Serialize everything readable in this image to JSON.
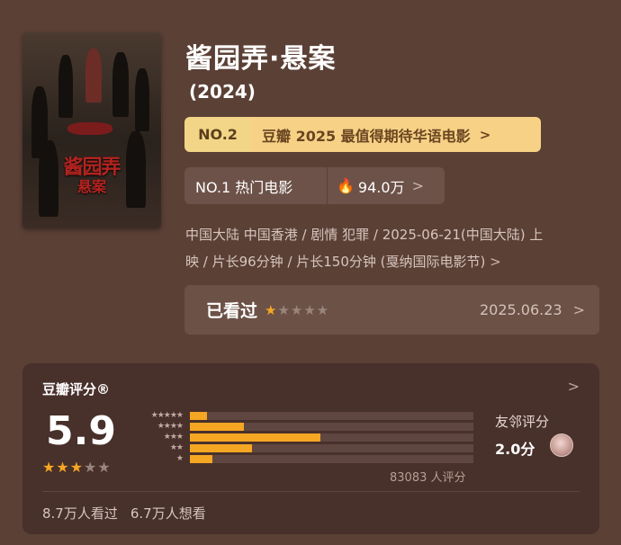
{
  "title": "酱园弄·悬案",
  "year": "(2024)",
  "poster": {
    "title_line1": "酱园弄",
    "title_line2": "悬案"
  },
  "rank1": {
    "no": "NO.2",
    "label": "豆瓣 2025 最值得期待华语电影"
  },
  "rank2": {
    "no_label": "NO.1 热门电影",
    "heat": "94.0万"
  },
  "meta": {
    "line1": "中国大陆 中国香港 / 剧情 犯罪 / 2025-06-21(中国大陆) 上",
    "line2": "映 / 片长96分钟 / 片长150分钟 (戛纳国际电影节)"
  },
  "watched": {
    "label": "已看过",
    "user_stars": 1,
    "date": "2025.06.23"
  },
  "rating": {
    "header": "豆瓣评分®",
    "score": "5.9",
    "stars": 3,
    "distribution": [
      {
        "stars": 5,
        "label": "★★★★★",
        "percent": 6
      },
      {
        "stars": 4,
        "label": "★★★★",
        "percent": 19
      },
      {
        "stars": 3,
        "label": "★★★",
        "percent": 46
      },
      {
        "stars": 2,
        "label": "★★",
        "percent": 22
      },
      {
        "stars": 1,
        "label": "★",
        "percent": 8
      }
    ],
    "count_text": "83083 人评分"
  },
  "friend": {
    "label": "友邻评分",
    "score": "2.0分"
  },
  "bottom": {
    "watched": "8.7万人看过",
    "want": "6.7万人想看"
  },
  "colors": {
    "star_on": "#f5a623",
    "star_off": "#9a857d",
    "bg": "#5b4036"
  }
}
